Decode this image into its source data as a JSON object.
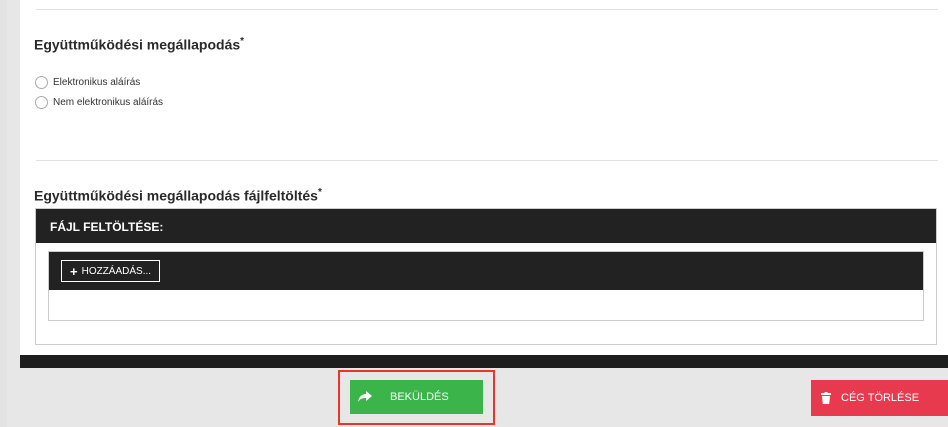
{
  "agreement": {
    "title": "Együttműködési megállapodás",
    "required_marker": "*",
    "options": [
      {
        "label": "Elektronikus aláírás",
        "selected": false
      },
      {
        "label": "Nem elektronikus aláírás",
        "selected": false
      }
    ]
  },
  "upload": {
    "title": "Együttműködési megállapodás fájlfeltöltés",
    "required_marker": "*",
    "header_label": "FÁJL FELTÖLTÉSE:",
    "add_label": "HOZZÁADÁS..."
  },
  "actions": {
    "submit_label": "BEKÜLDÉS",
    "delete_label": "CÉG TÖRLÉSE"
  },
  "colors": {
    "submit": "#3bb54a",
    "delete": "#e83a4f",
    "highlight": "#e8362b",
    "dark": "#222222"
  },
  "icons": {
    "submit": "share-arrow-icon",
    "delete": "trash-icon",
    "add": "plus-icon"
  }
}
